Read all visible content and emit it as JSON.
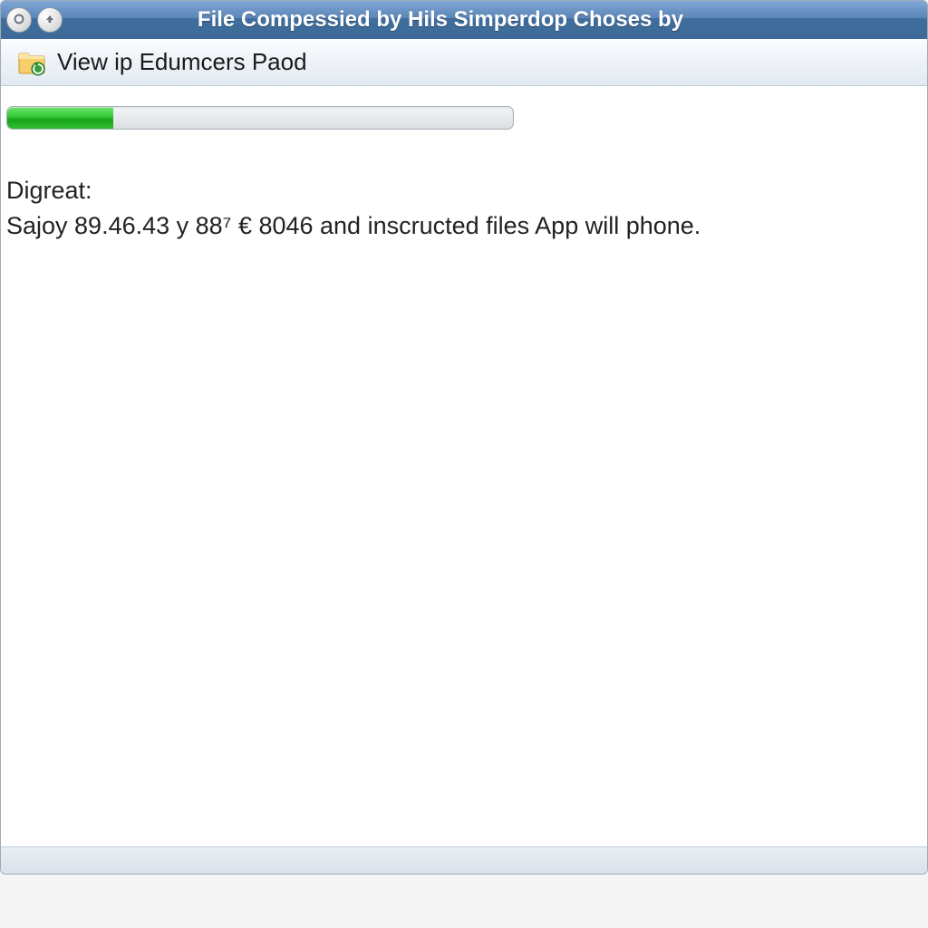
{
  "window": {
    "title": "File Compessied by Hils Simperdop Choses by"
  },
  "toolbar": {
    "label": "View ip Edumcers Paod",
    "icon": "folder-refresh-icon"
  },
  "progress": {
    "percent": 21
  },
  "message": {
    "heading": "Digreat:",
    "body": "Sajoy 89.46.43 y 88⁷ € 8046 and inscructed files App will phone."
  },
  "colors": {
    "titlebar_top": "#7fa8d6",
    "titlebar_bottom": "#3d6a98",
    "progress_fill": "#2fbf2f"
  }
}
